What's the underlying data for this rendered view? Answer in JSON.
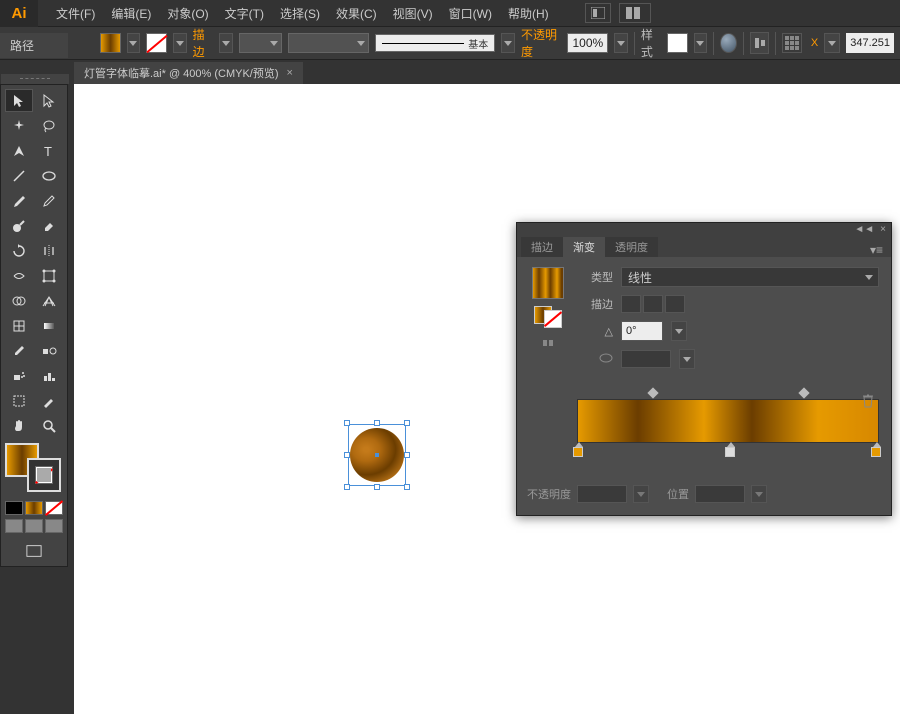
{
  "app": {
    "logo": "Ai"
  },
  "menu": {
    "items": [
      "文件(F)",
      "编辑(E)",
      "对象(O)",
      "文字(T)",
      "选择(S)",
      "效果(C)",
      "视图(V)",
      "窗口(W)",
      "帮助(H)"
    ]
  },
  "sideLabel": "路径",
  "optionsbar": {
    "stroke_label": "描边",
    "stroke_weight": "",
    "brush_label": "基本",
    "opacity_label": "不透明度",
    "opacity_value": "100%",
    "style_label": "样式",
    "coord_x_label": "X",
    "coord_x_value": "347.251"
  },
  "docTab": {
    "title": "灯管字体临摹.ai* @ 400% (CMYK/预览)",
    "close": "×"
  },
  "panel": {
    "tabs": [
      "描边",
      "渐变",
      "透明度"
    ],
    "type_label": "类型",
    "type_value": "线性",
    "stroke_label": "描边",
    "angle_symbol": "△",
    "angle_value": "0°",
    "opacity_label": "不透明度",
    "location_label": "位置"
  },
  "colors": {
    "accent": "#ff9a00",
    "grad_a": "#e69a00",
    "grad_b": "#6b3d00"
  }
}
